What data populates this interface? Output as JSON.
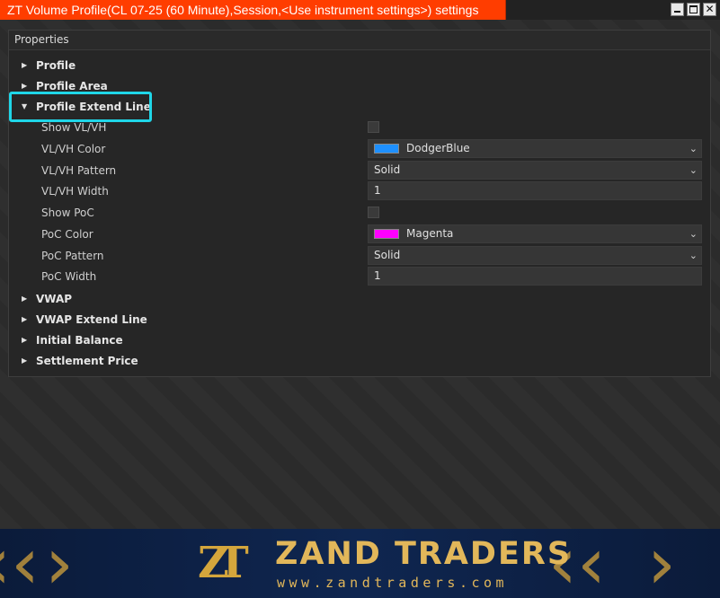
{
  "window": {
    "title": "ZT Volume Profile(CL 07-25 (60 Minute),Session,<Use instrument settings>) settings",
    "minimize_glyph": "",
    "close_glyph": "✕"
  },
  "panel": {
    "header": "Properties",
    "categories_top": [
      {
        "label": "Profile",
        "expanded": false
      },
      {
        "label": "Profile Area",
        "expanded": false
      },
      {
        "label": "Profile Extend Line",
        "expanded": true
      }
    ],
    "properties": [
      {
        "label": "Show VL/VH",
        "type": "checkbox",
        "checked": false
      },
      {
        "label": "VL/VH Color",
        "type": "color",
        "value": "DodgerBlue",
        "swatch": "#1e90ff"
      },
      {
        "label": "VL/VH Pattern",
        "type": "select",
        "value": "Solid"
      },
      {
        "label": "VL/VH Width",
        "type": "text",
        "value": "1"
      },
      {
        "label": "Show PoC",
        "type": "checkbox",
        "checked": false
      },
      {
        "label": "PoC Color",
        "type": "color",
        "value": "Magenta",
        "swatch": "#ff00ff"
      },
      {
        "label": "PoC Pattern",
        "type": "select",
        "value": "Solid"
      },
      {
        "label": "PoC Width",
        "type": "text",
        "value": "1"
      }
    ],
    "categories_bottom": [
      {
        "label": "VWAP",
        "expanded": false
      },
      {
        "label": "VWAP Extend Line",
        "expanded": false
      },
      {
        "label": "Initial Balance",
        "expanded": false
      },
      {
        "label": "Settlement Price",
        "expanded": false
      }
    ]
  },
  "banner": {
    "brand": "ZAND TRADERS",
    "url": "www.zandtraders.com",
    "logo_letters": "ZT"
  },
  "colors": {
    "title_bar": "#ff3d00",
    "highlight": "#1fd6e8",
    "brand_gold": "#e2b75a",
    "banner_bg": "#0f2650"
  },
  "icons": {
    "collapsed": "triangle-right-icon",
    "expanded": "triangle-down-icon",
    "dropdown": "chevron-down-icon"
  }
}
